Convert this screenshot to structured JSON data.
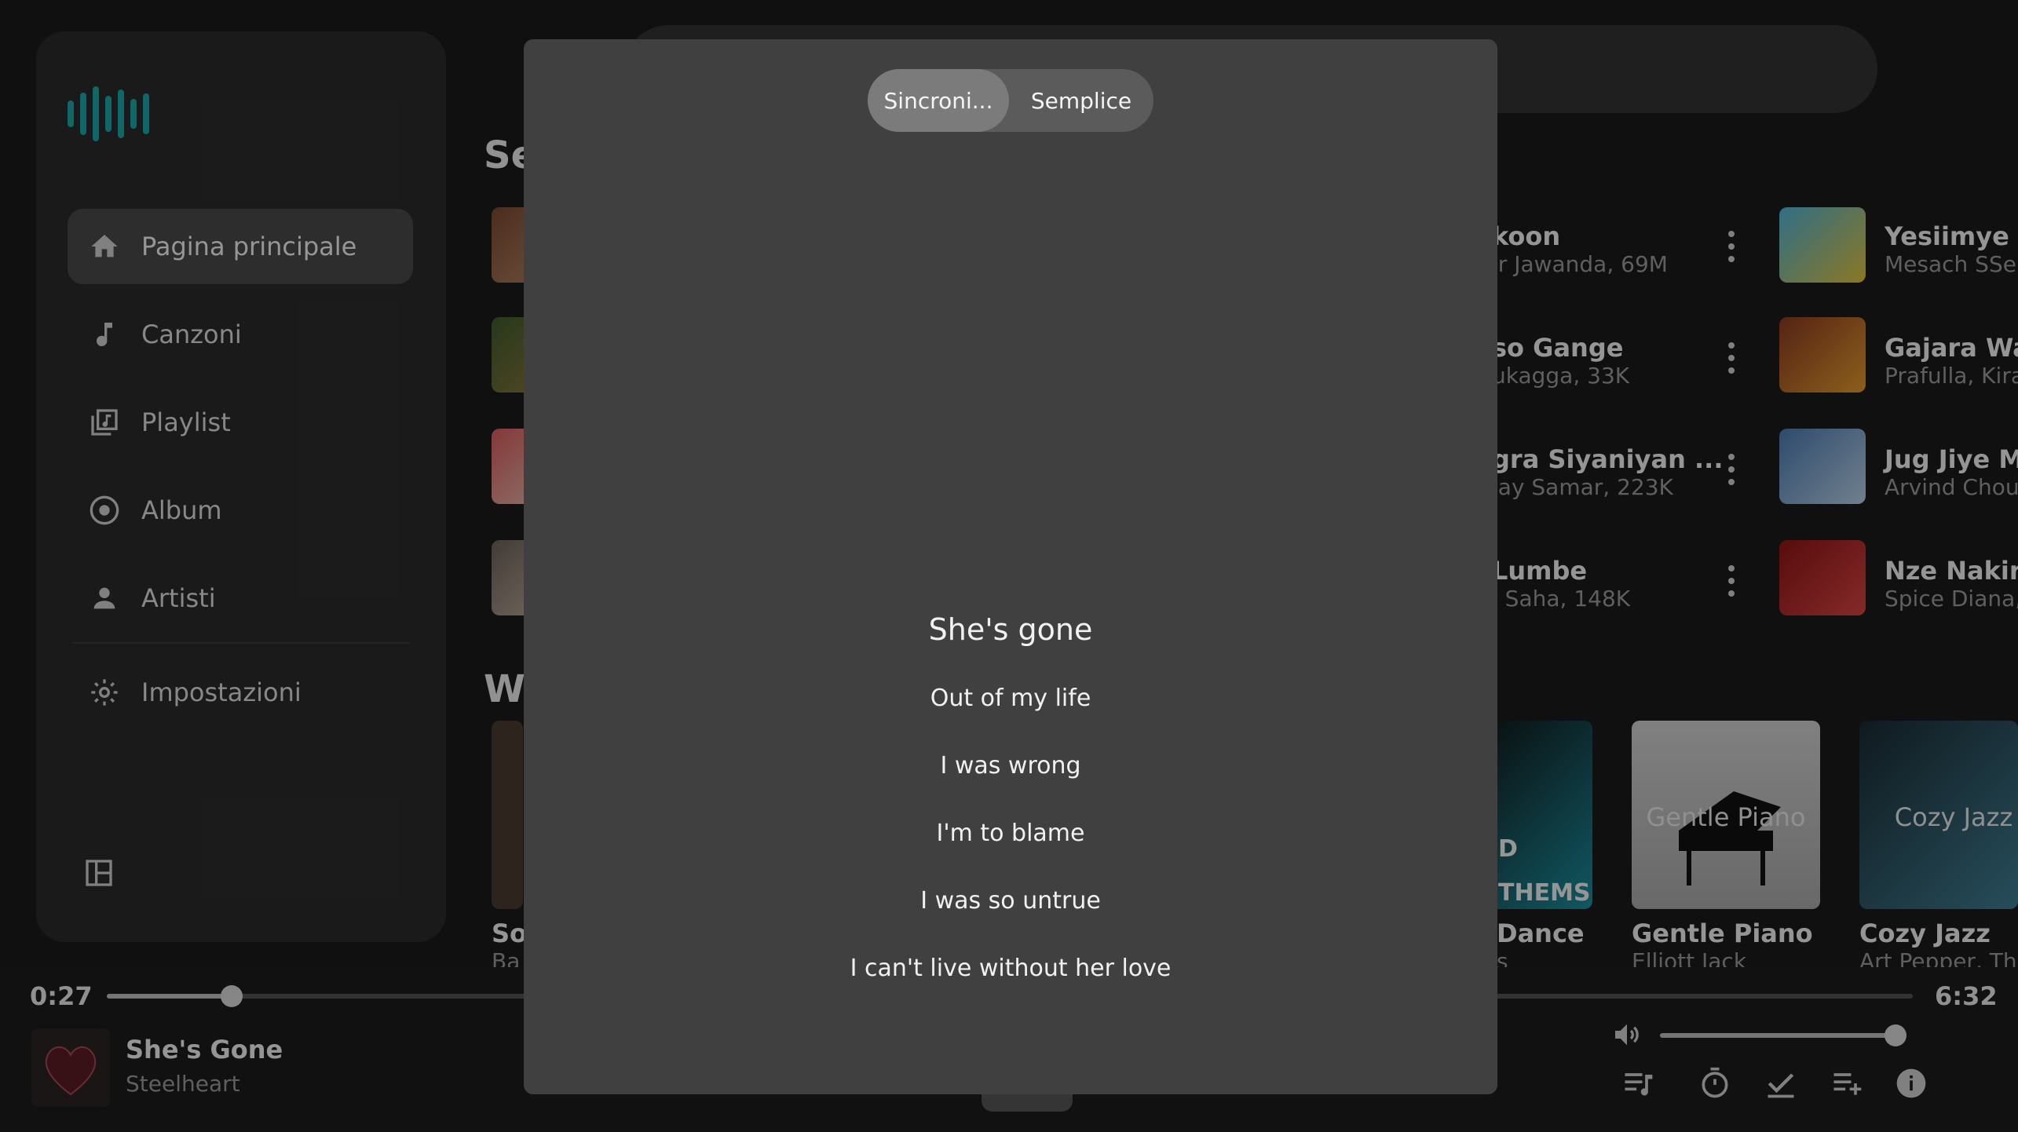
{
  "sidebar": {
    "items": [
      {
        "label": "Pagina principale",
        "icon": "home-icon",
        "active": true
      },
      {
        "label": "Canzoni",
        "icon": "music-note-icon",
        "active": false
      },
      {
        "label": "Playlist",
        "icon": "playlist-icon",
        "active": false
      },
      {
        "label": "Album",
        "icon": "album-icon",
        "active": false
      },
      {
        "label": "Artisti",
        "icon": "person-icon",
        "active": false
      },
      {
        "label": "Impostazioni",
        "icon": "gear-icon",
        "active": false
      }
    ]
  },
  "main": {
    "section1_title": "Se",
    "section2_title": "W",
    "left_card_title": "So",
    "left_card_sub": "Ba",
    "songs_mid": [
      {
        "title": "koon",
        "sub": "ir Jawanda, 69M"
      },
      {
        "title": "so Gange",
        "sub": "ukagga, 33K"
      },
      {
        "title": "gra Siyaniyan ...",
        "sub": "jay Samar, 223K"
      },
      {
        "title": "Lumbe",
        "sub": "j Saha, 148K"
      }
    ],
    "songs_right": [
      {
        "title": "Yesiimye",
        "sub": "Mesach SSe"
      },
      {
        "title": "Gajara Wal",
        "sub": "Prafulla, Kira"
      },
      {
        "title": "Jug Jiye M",
        "sub": "Arvind Chou"
      },
      {
        "title": "Nze Nakiriz",
        "sub": "Spice Diana,"
      }
    ],
    "cards": [
      {
        "title": "Dance",
        "sub": "s",
        "overlay_top": "D",
        "overlay_bottom": "THEMS"
      },
      {
        "title": "Gentle Piano",
        "sub": "Elliott Jack",
        "overlay": "Gentle Piano"
      },
      {
        "title": "Cozy Jazz",
        "sub": "Art Pepper, The",
        "overlay": "Cozy Jazz"
      }
    ]
  },
  "player": {
    "elapsed": "0:27",
    "duration": "6:32",
    "progress_fraction": 0.069,
    "volume_fraction": 1.0,
    "track_title": "She's Gone",
    "track_artist": "Steelheart",
    "controls": [
      "queue-icon",
      "timer-icon",
      "check-icon",
      "playlist-add-icon",
      "info-icon"
    ]
  },
  "lyrics_modal": {
    "tabs": [
      "Sincroni...",
      "Semplice"
    ],
    "selected_tab": "Sincroni...",
    "lines": [
      "She's gone",
      "Out of my life",
      "I was wrong",
      "I'm to blame",
      "I was so untrue",
      "I can't live without her love"
    ]
  },
  "colors": {
    "accent_logo": "#1aa6a6",
    "modal_bg": "#404041",
    "sidebar_bg": "#2b2b2b"
  }
}
